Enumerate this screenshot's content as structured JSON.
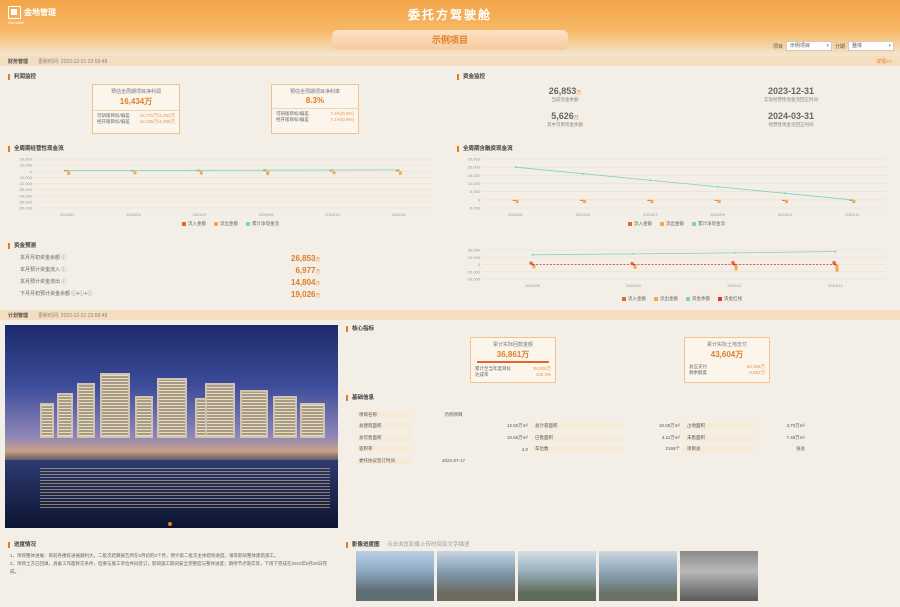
{
  "header": {
    "logo_text": "金地管理",
    "logo_sub": "Gemdale",
    "app_title": "委托方驾驶舱",
    "project_banner": "示例项目",
    "project_label": "项目",
    "project_value": "示例项目",
    "period_label": "分期",
    "period_value": "整体"
  },
  "finance": {
    "section_title": "财务管理",
    "update_time": "更新时间: 2023-12-31 23:59:48",
    "more": "详情>>",
    "profit": {
      "title": "利润监控",
      "box1": {
        "label": "预估全周期项目净利润",
        "value": "16,434万",
        "rows": [
          {
            "l": "可研版目标/偏差",
            "v": "12,772万/4,263万"
          },
          {
            "l": "经开版目标/偏差",
            "v": "12,336万/4,098万"
          }
        ]
      },
      "box2": {
        "label": "预估全周期项目净利率",
        "value": "8.3%",
        "rows": [
          {
            "l": "可研版目标/偏差",
            "v": "7.4%(0.9%)"
          },
          {
            "l": "经开版目标/偏差",
            "v": "7.1%(0.8%)"
          }
        ]
      }
    },
    "capital": {
      "title": "资金监控",
      "items": [
        {
          "v": "26,853",
          "unit": "万",
          "l": "当前资金余额"
        },
        {
          "v": "2023-12-31",
          "unit": "",
          "l": "实现经营性现金流回正时间"
        },
        {
          "v": "5,626",
          "unit": "万",
          "l": "其中可用资金余额"
        },
        {
          "v": "2024-03-31",
          "unit": "",
          "l": "经营性现金流回正时间"
        }
      ]
    },
    "cashflow_title": "全周期经营性现金流",
    "total_cf_title": "全周期含融资现金流",
    "funds": {
      "title": "资金预测",
      "rows": [
        {
          "l": "本月月初资金余额 ⓘ",
          "v": "26,853",
          "u": "万"
        },
        {
          "l": "本月预计资金流入 ⓘ",
          "v": "6,977",
          "u": "万"
        },
        {
          "l": "本月预计资金流出 ⓘ",
          "v": "14,804",
          "u": "万"
        },
        {
          "l": "下月月初预计资金余额 ⓘ+ⓘ+ⓘ",
          "v": "19,026",
          "u": "万"
        }
      ]
    },
    "legend1": [
      "流入金额",
      "流出金额",
      "累计净现金流"
    ],
    "legend3": [
      "流入金额",
      "流出金额",
      "资金余额",
      "资金红线"
    ]
  },
  "plan": {
    "section_title": "计划管理",
    "update_time": "更新时间: 2023-12-31 23:59:48",
    "core": {
      "title": "核心指标",
      "box1": {
        "label": "累计实际回款金额",
        "value": "36,861万",
        "rows": [
          {
            "l": "累计至当年度目标",
            "v": "35,000万"
          },
          {
            "l": "达成率",
            "v": "105.3%"
          }
        ]
      },
      "box2": {
        "label": "累计实际土地支付",
        "value": "43,604万",
        "rows": [
          {
            "l": "总应支付",
            "v": "53,356万"
          },
          {
            "l": "剩余额度",
            "v": "9,682万"
          }
        ]
      }
    },
    "basic": {
      "title": "基础信息",
      "rows": [
        [
          {
            "l": "项目名称",
            "v": "示例项目"
          }
        ],
        [
          {
            "l": "总建筑面积",
            "v": "12.50万m²"
          },
          {
            "l": "总计容面积",
            "v": "10.00万m²"
          },
          {
            "l": "占地面积",
            "v": "3.70万m²"
          }
        ],
        [
          {
            "l": "总可售面积",
            "v": "10.60万m²"
          },
          {
            "l": "已售面积",
            "v": "3.11万m²"
          },
          {
            "l": "未售面积",
            "v": "7.49万m²"
          }
        ],
        [
          {
            "l": "容积率",
            "v": "4.0"
          },
          {
            "l": "车位数",
            "v": "2169个"
          },
          {
            "l": "项目总",
            "v": "张总"
          }
        ],
        [
          {
            "l": "委托协议签订时间",
            "v": "2022-07-17"
          }
        ]
      ]
    },
    "progress": {
      "title": "进度情况",
      "lines": [
        "1、项目整体进展：目前各楼栋进展顺利大，二批次结算报告所在6月初的2个月，预计第二批次主体结构进度，请等影响整体建筑施工。",
        "2、项目土方已回填，具备工作面移交条件，但要与施工单位共同签订，影响施工期间安全完整度与整体进度；期待节点落实等，下周下完成在2023年8月20日完成。"
      ]
    },
    "images": {
      "title": "影像进度图",
      "note": "点击浏览影像上传时间及文字描述"
    }
  },
  "chart_data": [
    {
      "type": "bar",
      "title": "全周期经营性现金流",
      "categories": [
        "2024/01",
        "2024/04",
        "2024/07",
        "2024/09",
        "2024/10",
        "2024/11"
      ],
      "ylim": [
        -60000,
        20000
      ],
      "series": [
        {
          "name": "流入金额",
          "values": [
            2000,
            1500,
            2500,
            3000,
            1800,
            2200
          ]
        },
        {
          "name": "流出金额",
          "values": [
            -6000,
            -5000,
            -5500,
            -6200,
            -4800,
            -5600
          ]
        },
        {
          "name": "累计净现金流",
          "values": [
            1000,
            1200,
            1500,
            1700,
            2000,
            2300
          ]
        }
      ]
    },
    {
      "type": "bar",
      "title": "全周期含融资现金流",
      "categories": [
        "2024/01",
        "2024/04",
        "2024/07",
        "2024/09",
        "2024/10",
        "2024/11"
      ],
      "ylim": [
        -5000,
        25000
      ],
      "series": [
        {
          "name": "流入金额",
          "values": [
            0,
            0,
            0,
            0,
            0,
            0
          ]
        },
        {
          "name": "流出金额",
          "values": [
            -2000,
            -2000,
            -2000,
            -2000,
            -2000,
            -2000
          ]
        },
        {
          "name": "累计净现金流",
          "values": [
            20000,
            16000,
            12000,
            8000,
            4000,
            0
          ]
        }
      ]
    },
    {
      "type": "bar",
      "title": "资金预测",
      "categories": [
        "2023/08",
        "2023/10",
        "2023/11",
        "2023/12"
      ],
      "ylim": [
        -30000,
        30000
      ],
      "series": [
        {
          "name": "流入金额",
          "values": [
            6000,
            5000,
            7000,
            6977
          ]
        },
        {
          "name": "流出金额",
          "values": [
            -8000,
            -9000,
            -12000,
            -14804
          ]
        },
        {
          "name": "资金余额",
          "values": [
            20000,
            22000,
            24000,
            26853
          ]
        },
        {
          "name": "资金红线",
          "values": [
            0,
            0,
            0,
            0
          ]
        }
      ]
    }
  ],
  "colors": {
    "accent": "#e07d25",
    "inflow": "#e8632f",
    "outflow": "#f3a94e",
    "line": "#7fd5b5",
    "redline": "#d33"
  }
}
